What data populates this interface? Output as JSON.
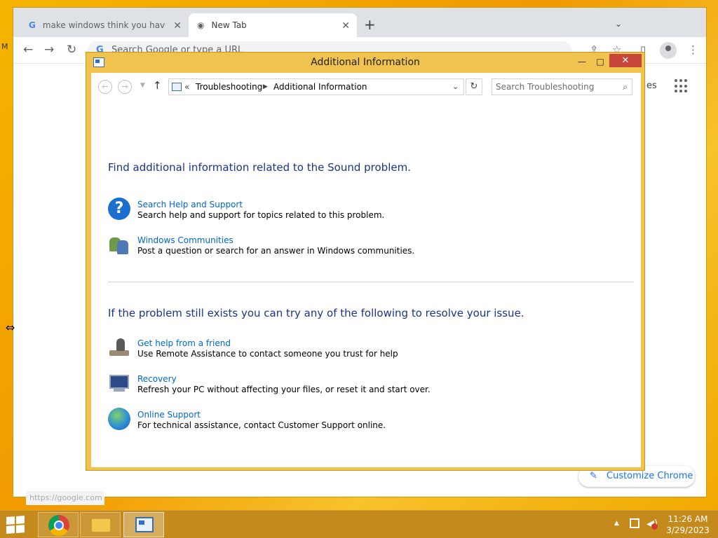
{
  "browser": {
    "tabs": [
      {
        "title": "make windows think you have so"
      },
      {
        "title": "New Tab"
      }
    ],
    "omnibox_placeholder": "Search Google or type a URL",
    "ntp_links_fragment": "es",
    "customize_label": "Customize Chrome",
    "status_url": "https://google.com",
    "side_letter": "M"
  },
  "dialog": {
    "title": "Additional Information",
    "breadcrumb": [
      "Troubleshooting",
      "Additional Information"
    ],
    "breadcrumb_prefix": "«",
    "search_placeholder": "Search Troubleshooting",
    "section1_heading": "Find additional information related to the Sound problem.",
    "section1_items": [
      {
        "link": "Search Help and Support",
        "desc": "Search help and support for topics related to this problem.",
        "icon": "help-icon"
      },
      {
        "link": "Windows Communities",
        "desc": "Post a question or search for an answer in Windows communities.",
        "icon": "communities-icon"
      }
    ],
    "section2_heading": "If the problem still exists you can try any of the following to resolve your issue.",
    "section2_items": [
      {
        "link": "Get help from a friend",
        "desc": "Use Remote Assistance to contact someone you trust for help",
        "icon": "remote-assistance-icon"
      },
      {
        "link": "Recovery",
        "desc": "Refresh your PC without affecting your files, or reset it and start over.",
        "icon": "recovery-icon"
      },
      {
        "link": "Online Support",
        "desc": "For technical assistance, contact Customer Support online.",
        "icon": "globe-icon"
      }
    ]
  },
  "taskbar": {
    "time": "11:26 AM",
    "date": "3/29/2023",
    "apps": [
      "chrome",
      "file-explorer",
      "control-panel"
    ]
  },
  "colors": {
    "accent_border": "#f0c24e",
    "heading": "#1e3287",
    "link": "#0066cc",
    "close_red": "#c7453b"
  }
}
